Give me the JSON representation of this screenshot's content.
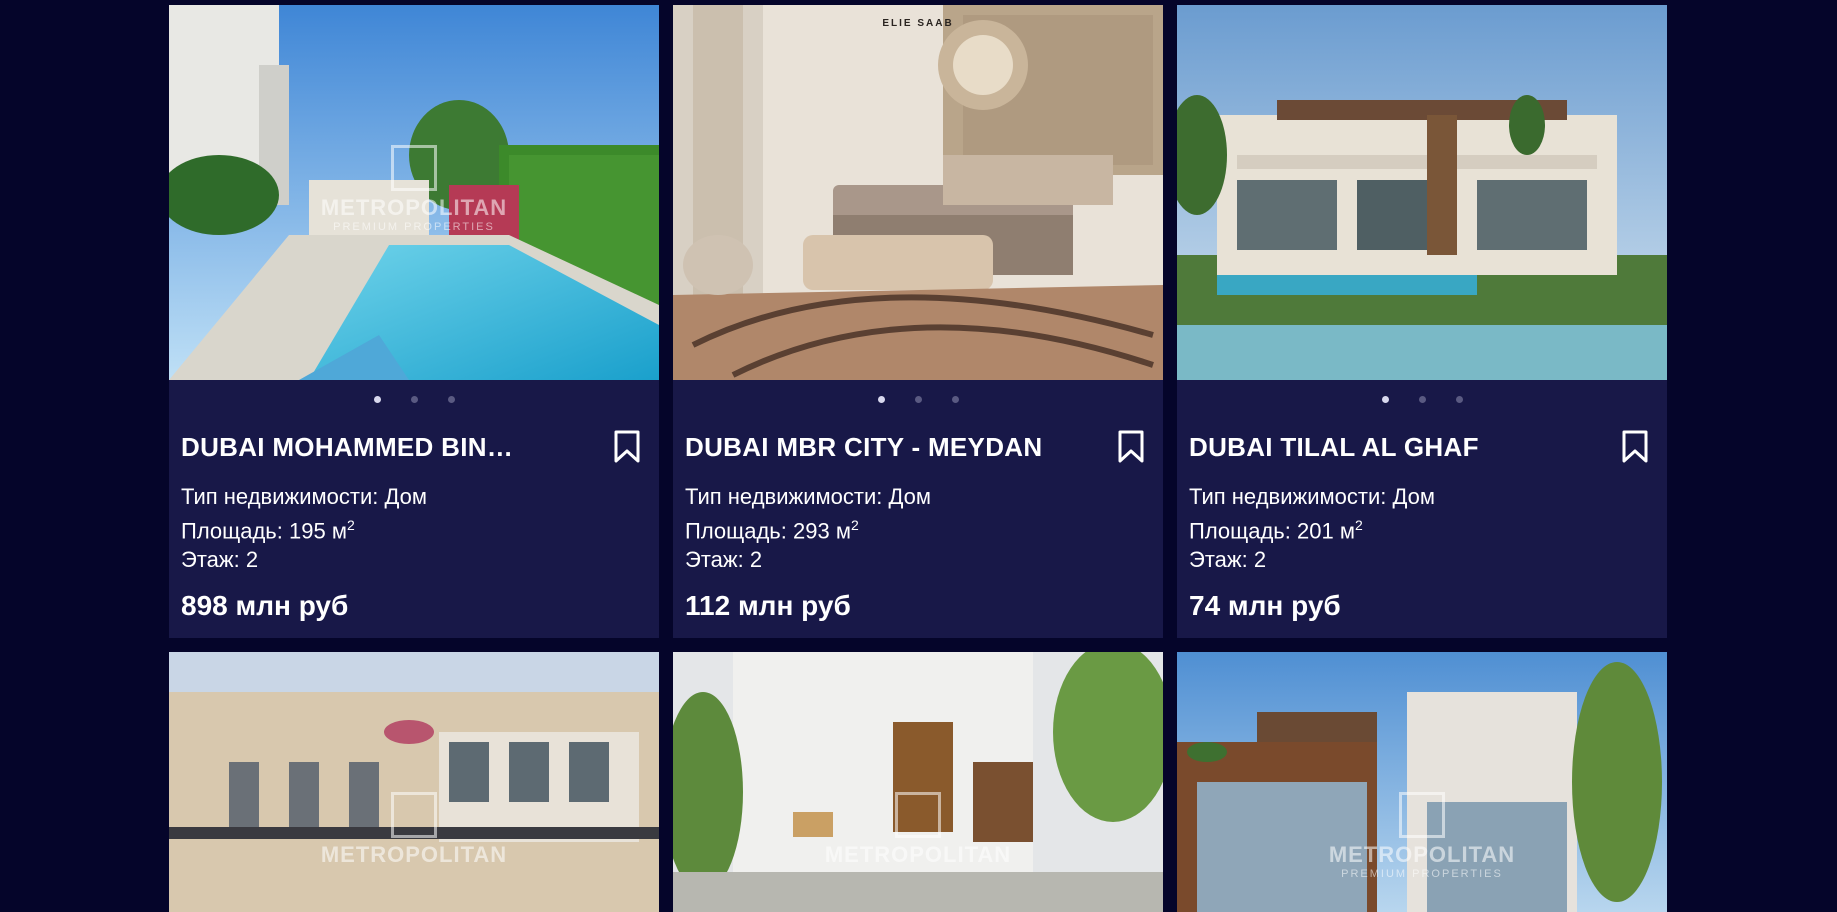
{
  "watermark": {
    "name": "METROPOLITAN",
    "sub": "PREMIUM PROPERTIES"
  },
  "cards": [
    {
      "title": "DUBAI MOHAMMED BIN…",
      "type_label": "Тип недвижимости:",
      "type_value": "Дом",
      "area_label": "Площадь:",
      "area_value": "195 м",
      "area_sup": "2",
      "floor_label": "Этаж:",
      "floor_value": "2",
      "price": "898 млн руб",
      "active_slide": 1,
      "slides": 3
    },
    {
      "title": "DUBAI MBR CITY - MEYDAN",
      "brand_tag": "ELIE SAAB",
      "type_label": "Тип недвижимости:",
      "type_value": "Дом",
      "area_label": "Площадь:",
      "area_value": "293 м",
      "area_sup": "2",
      "floor_label": "Этаж:",
      "floor_value": "2",
      "price": "112 млн руб",
      "active_slide": 1,
      "slides": 3
    },
    {
      "title": "DUBAI TILAL AL GHAF",
      "type_label": "Тип недвижимости:",
      "type_value": "Дом",
      "area_label": "Площадь:",
      "area_value": "201 м",
      "area_sup": "2",
      "floor_label": "Этаж:",
      "floor_value": "2",
      "price": "74 млн руб",
      "active_slide": 1,
      "slides": 3
    }
  ],
  "colors": {
    "background": "#05052a",
    "card": "#181848",
    "dot_active": "#d8d8ee",
    "dot_inactive": "#5a5a82"
  }
}
